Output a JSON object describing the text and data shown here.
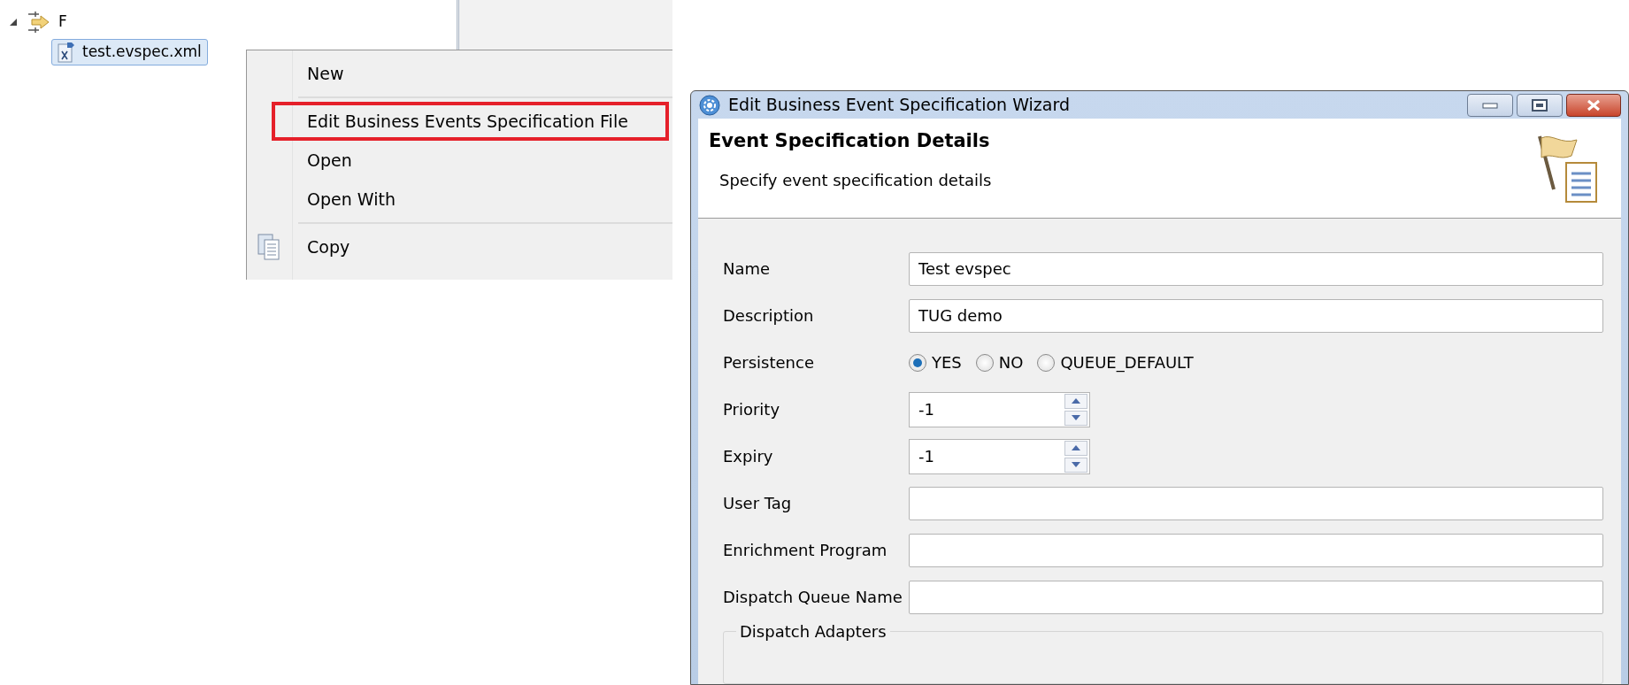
{
  "tree": {
    "label": "F",
    "expanded": true,
    "children": [
      {
        "label": "test.evspec.xml",
        "selected": true
      }
    ]
  },
  "context_menu": {
    "items": [
      {
        "kind": "item",
        "label": "New",
        "highlighted": false
      },
      {
        "kind": "separator"
      },
      {
        "kind": "item",
        "label": "Edit Business Events Specification File",
        "highlighted": true
      },
      {
        "kind": "item",
        "label": "Open",
        "highlighted": false
      },
      {
        "kind": "item",
        "label": "Open With",
        "highlighted": false
      },
      {
        "kind": "separator"
      },
      {
        "kind": "icon_item",
        "label": "Copy",
        "highlighted": false
      }
    ]
  },
  "dialog": {
    "title": "Edit Business Event Specification Wizard",
    "page_title": "Event Specification Details",
    "page_description": "Specify event specification details",
    "fields": [
      {
        "kind": "text",
        "label": "Name",
        "value": "Test evspec"
      },
      {
        "kind": "text",
        "label": "Description",
        "value": "TUG demo"
      },
      {
        "kind": "radio",
        "label": "Persistence",
        "options": [
          {
            "label": "YES",
            "selected": true
          },
          {
            "label": "NO",
            "selected": false
          },
          {
            "label": "QUEUE_DEFAULT",
            "selected": false
          }
        ]
      },
      {
        "kind": "spinner",
        "label": "Priority",
        "value": "-1"
      },
      {
        "kind": "spinner",
        "label": "Expiry",
        "value": "-1"
      },
      {
        "kind": "text",
        "label": "User Tag"
      },
      {
        "kind": "text",
        "label": "Enrichment Program"
      },
      {
        "kind": "text",
        "label": "Dispatch Queue Name"
      }
    ],
    "group": {
      "title": "Dispatch Adapters"
    }
  }
}
